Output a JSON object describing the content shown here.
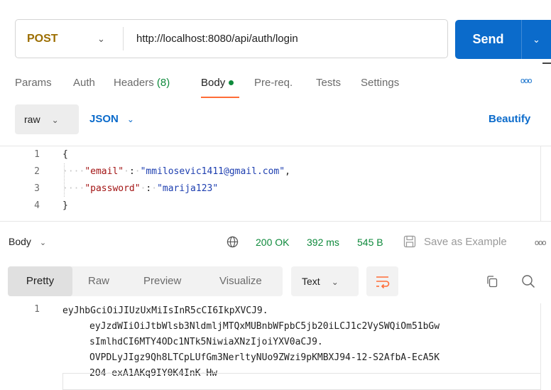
{
  "request": {
    "method": "POST",
    "url": "http://localhost:8080/api/auth/login",
    "send_label": "Send"
  },
  "request_tabs": [
    {
      "label": "Params"
    },
    {
      "label": "Auth"
    },
    {
      "label": "Headers",
      "count": "(8)"
    },
    {
      "label": "Body"
    },
    {
      "label": "Pre-req."
    },
    {
      "label": "Tests"
    },
    {
      "label": "Settings"
    }
  ],
  "more_label": "ooo",
  "body_mode": {
    "mode": "raw",
    "format": "JSON",
    "beautify_label": "Beautify"
  },
  "editor": {
    "line_numbers": [
      "1",
      "2",
      "3",
      "4"
    ],
    "open_brace": "{",
    "close_brace": "}",
    "fields": [
      {
        "key": "\"email\"",
        "value": "\"mmilosevic1411@gmail.com\"",
        "trailing": ","
      },
      {
        "key": "\"password\"",
        "value": "\"marija123\"",
        "trailing": ""
      }
    ]
  },
  "response": {
    "body_label": "Body",
    "status": "200 OK",
    "time": "392 ms",
    "size": "545 B",
    "save_example_label": "Save as Example",
    "view_tabs": [
      "Pretty",
      "Raw",
      "Preview",
      "Visualize"
    ],
    "text_format": "Text",
    "line_number": "1",
    "lines": [
      "eyJhbGciOiJIUzUxMiIsInR5cCI6IkpXVCJ9.",
      "eyJzdWIiOiJtbWlsb3NldmljMTQxMUBnbWFpbC5jb20iLCJ1c2VySWQiOm51bGw",
      "sImlhdCI6MTY4ODc1NTk5NiwiaXNzIjoiYXV0aCJ9.",
      "OVPDLyJIgz9Qh8LTCpLUfGm3NerltyNUo9ZWzi9pKMBXJ94-12-S2AfbA-EcA5K",
      "2O4-exA1AKq9IY0K4InK-Hw"
    ]
  },
  "colors": {
    "accent": "#0b6bcb",
    "method": "#9c6e00",
    "success": "#0f8a3c",
    "active_tab_underline": "#ff6c37"
  },
  "icons": [
    "chevron-down-icon",
    "globe-icon",
    "save-icon",
    "wrap-lines-icon",
    "copy-icon",
    "search-icon"
  ]
}
